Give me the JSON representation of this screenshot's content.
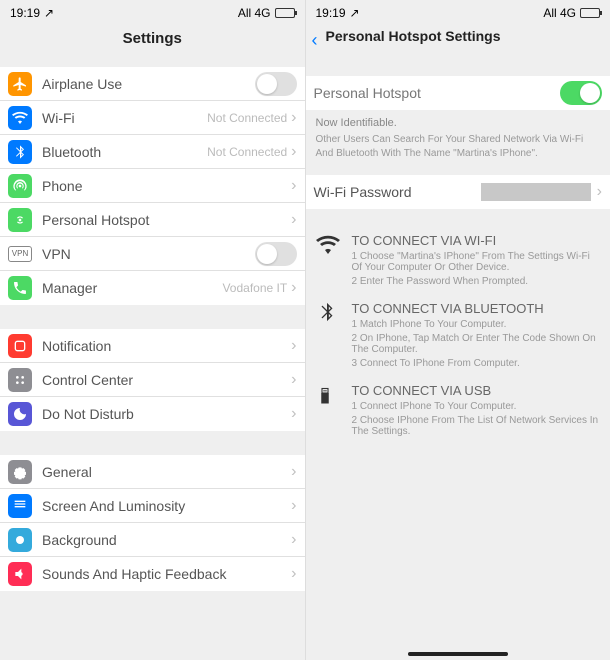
{
  "status": {
    "time": "19:19",
    "network": "All 4G"
  },
  "left": {
    "title": "Settings",
    "groups": [
      [
        {
          "icon": "airplane",
          "label": "Airplane Use",
          "toggle": "off"
        },
        {
          "icon": "wifi",
          "label": "Wi-Fi",
          "value": "Not Connected"
        },
        {
          "icon": "bluetooth",
          "label": "Bluetooth",
          "value": "Not Connected"
        },
        {
          "icon": "phone",
          "label": "Phone"
        },
        {
          "icon": "hotspot",
          "label": "Personal Hotspot"
        },
        {
          "icon": "vpn",
          "label": "VPN",
          "toggle": "off"
        },
        {
          "icon": "manager",
          "label": "Manager",
          "value": "Vodafone IT"
        }
      ],
      [
        {
          "icon": "notification",
          "label": "Notification"
        },
        {
          "icon": "control",
          "label": "Control Center"
        },
        {
          "icon": "dnd",
          "label": "Do Not Disturb"
        }
      ],
      [
        {
          "icon": "general",
          "label": "General"
        },
        {
          "icon": "screen",
          "label": "Screen And Luminosity"
        },
        {
          "icon": "background",
          "label": "Background"
        },
        {
          "icon": "sounds",
          "label": "Sounds And Haptic Feedback"
        }
      ]
    ]
  },
  "right": {
    "title": "Personal Hotspot Settings",
    "hotspot_label": "Personal Hotspot",
    "hotspot_on": true,
    "info_title": "Now Identifiable.",
    "info_body": "Other Users Can Search For Your Shared Network Via Wi-Fi And Bluetooth With The Name \"Martina's IPhone\".",
    "wifi_pw_label": "Wi-Fi Password",
    "inst_wifi_title": "TO CONNECT VIA WI-FI",
    "inst_wifi_1": "1 Choose \"Martina's IPhone\" From The Settings Wi-Fi Of Your Computer Or Other Device.",
    "inst_wifi_2": "2 Enter The Password When Prompted.",
    "inst_bt_title": "TO CONNECT VIA BLUETOOTH",
    "inst_bt_1": "1 Match IPhone To Your Computer.",
    "inst_bt_2": "2 On IPhone, Tap Match Or Enter The Code Shown On The Computer.",
    "inst_bt_3": "3 Connect To IPhone From Computer.",
    "inst_usb_title": "TO CONNECT VIA USB",
    "inst_usb_1": "1 Connect IPhone To Your Computer.",
    "inst_usb_2": "2 Choose IPhone From The List Of Network Services In The Settings."
  }
}
